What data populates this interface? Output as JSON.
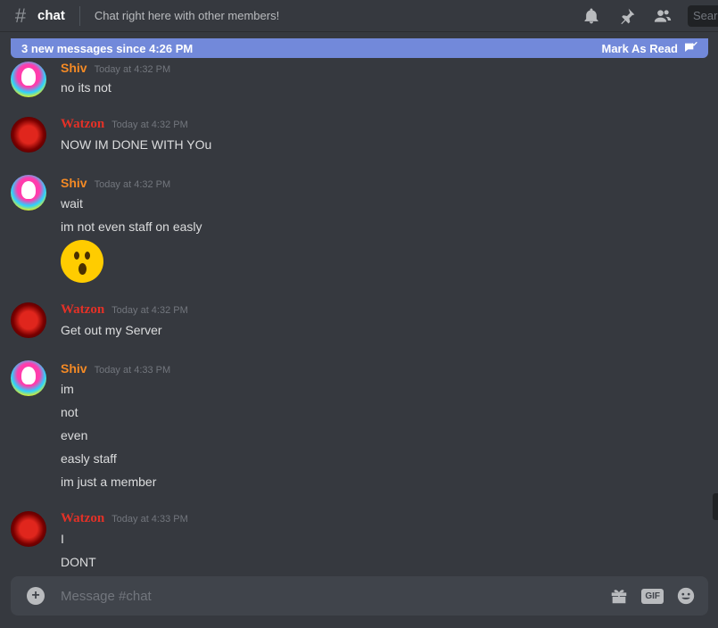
{
  "header": {
    "channel_name": "chat",
    "topic": "Chat right here with other members!",
    "search_placeholder": "Search"
  },
  "new_messages_bar": {
    "text": "3 new messages since 4:26 PM",
    "mark_as_read": "Mark As Read"
  },
  "messages": [
    {
      "author": "Shiv",
      "timestamp": "Today at 4:32 PM",
      "lines": [
        "no its not"
      ]
    },
    {
      "author": "Watzon",
      "timestamp": "Today at 4:32 PM",
      "lines": [
        "NOW IM DONE WITH YOu"
      ]
    },
    {
      "author": "Shiv",
      "timestamp": "Today at 4:32 PM",
      "lines": [
        "wait",
        "im not even staff on easly"
      ],
      "emoji": "hushed-face"
    },
    {
      "author": "Watzon",
      "timestamp": "Today at 4:32 PM",
      "lines": [
        "Get out my Server"
      ]
    },
    {
      "author": "Shiv",
      "timestamp": "Today at 4:33 PM",
      "lines": [
        "im",
        "not",
        "even",
        "easly staff",
        "im just a member"
      ]
    },
    {
      "author": "Watzon",
      "timestamp": "Today at 4:33 PM",
      "lines": [
        "I",
        "DONT"
      ]
    }
  ],
  "composer": {
    "placeholder": "Message #chat",
    "gif_label": "GIF"
  },
  "colors": {
    "background": "#36393f",
    "accent": "#7289da",
    "shiv_name": "#f48a25",
    "watzon_name": "#e33127"
  }
}
